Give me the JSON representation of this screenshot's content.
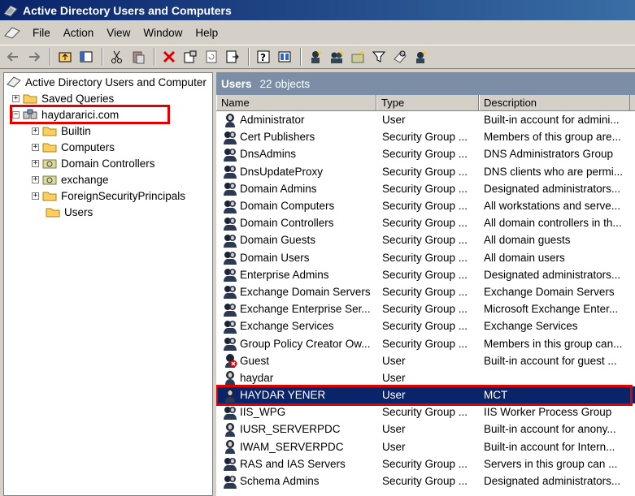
{
  "window": {
    "title": "Active Directory Users and Computers"
  },
  "menu": [
    {
      "label": "File"
    },
    {
      "label": "Action"
    },
    {
      "label": "View"
    },
    {
      "label": "Window"
    },
    {
      "label": "Help"
    }
  ],
  "toolbar": [
    "back-icon",
    "forward-icon",
    "up-folder-icon",
    "show-tree-icon",
    "cut-icon",
    "paste-icon",
    "delete-icon",
    "properties-icon",
    "refresh-icon",
    "export-icon",
    "help-icon",
    "console-icon",
    "new-user-icon",
    "new-group-icon",
    "new-ou-icon",
    "filter-icon",
    "find-icon",
    "add-to-group-icon"
  ],
  "tree": {
    "root": "Active Directory Users and Computer",
    "saved_queries": "Saved Queries",
    "domain": "haydararici.com",
    "children": [
      "Builtin",
      "Computers",
      "Domain Controllers",
      "exchange",
      "ForeignSecurityPrincipals",
      "Users"
    ]
  },
  "pane": {
    "title": "Users",
    "count": "22 objects",
    "columns": {
      "name": "Name",
      "type": "Type",
      "description": "Description"
    }
  },
  "rows": [
    {
      "name": "Administrator",
      "type": "User",
      "description": "Built-in account for admini...",
      "icon": "user-icon"
    },
    {
      "name": "Cert Publishers",
      "type": "Security Group ...",
      "description": "Members of this group are...",
      "icon": "group-icon"
    },
    {
      "name": "DnsAdmins",
      "type": "Security Group ...",
      "description": "DNS Administrators Group",
      "icon": "group-icon"
    },
    {
      "name": "DnsUpdateProxy",
      "type": "Security Group ...",
      "description": "DNS clients who are permi...",
      "icon": "group-icon"
    },
    {
      "name": "Domain Admins",
      "type": "Security Group ...",
      "description": "Designated administrators...",
      "icon": "group-icon"
    },
    {
      "name": "Domain Computers",
      "type": "Security Group ...",
      "description": "All workstations and serve...",
      "icon": "group-icon"
    },
    {
      "name": "Domain Controllers",
      "type": "Security Group ...",
      "description": "All domain controllers in th...",
      "icon": "group-icon"
    },
    {
      "name": "Domain Guests",
      "type": "Security Group ...",
      "description": "All domain guests",
      "icon": "group-icon"
    },
    {
      "name": "Domain Users",
      "type": "Security Group ...",
      "description": "All domain users",
      "icon": "group-icon"
    },
    {
      "name": "Enterprise Admins",
      "type": "Security Group ...",
      "description": "Designated administrators...",
      "icon": "group-icon"
    },
    {
      "name": "Exchange Domain Servers",
      "type": "Security Group ...",
      "description": "Exchange Domain Servers",
      "icon": "group-icon"
    },
    {
      "name": "Exchange Enterprise Ser...",
      "type": "Security Group ...",
      "description": "Microsoft Exchange Enter...",
      "icon": "group-icon"
    },
    {
      "name": "Exchange Services",
      "type": "Security Group ...",
      "description": "Exchange Services",
      "icon": "group-icon"
    },
    {
      "name": "Group Policy Creator Ow...",
      "type": "Security Group ...",
      "description": "Members in this group can...",
      "icon": "group-icon"
    },
    {
      "name": "Guest",
      "type": "User",
      "description": "Built-in account for guest ...",
      "icon": "disabled-user-icon"
    },
    {
      "name": "haydar",
      "type": "User",
      "description": "",
      "icon": "user-icon"
    },
    {
      "name": "HAYDAR YENER",
      "type": "User",
      "description": "MCT",
      "icon": "user-icon",
      "selected": true
    },
    {
      "name": "IIS_WPG",
      "type": "Security Group ...",
      "description": "IIS Worker Process Group",
      "icon": "group-icon"
    },
    {
      "name": "IUSR_SERVERPDC",
      "type": "User",
      "description": "Built-in account for anony...",
      "icon": "user-icon"
    },
    {
      "name": "IWAM_SERVERPDC",
      "type": "User",
      "description": "Built-in account for Intern...",
      "icon": "user-icon"
    },
    {
      "name": "RAS and IAS Servers",
      "type": "Security Group ...",
      "description": "Servers in this group can ...",
      "icon": "group-icon"
    },
    {
      "name": "Schema Admins",
      "type": "Security Group ...",
      "description": "Designated administrators...",
      "icon": "group-icon"
    }
  ]
}
